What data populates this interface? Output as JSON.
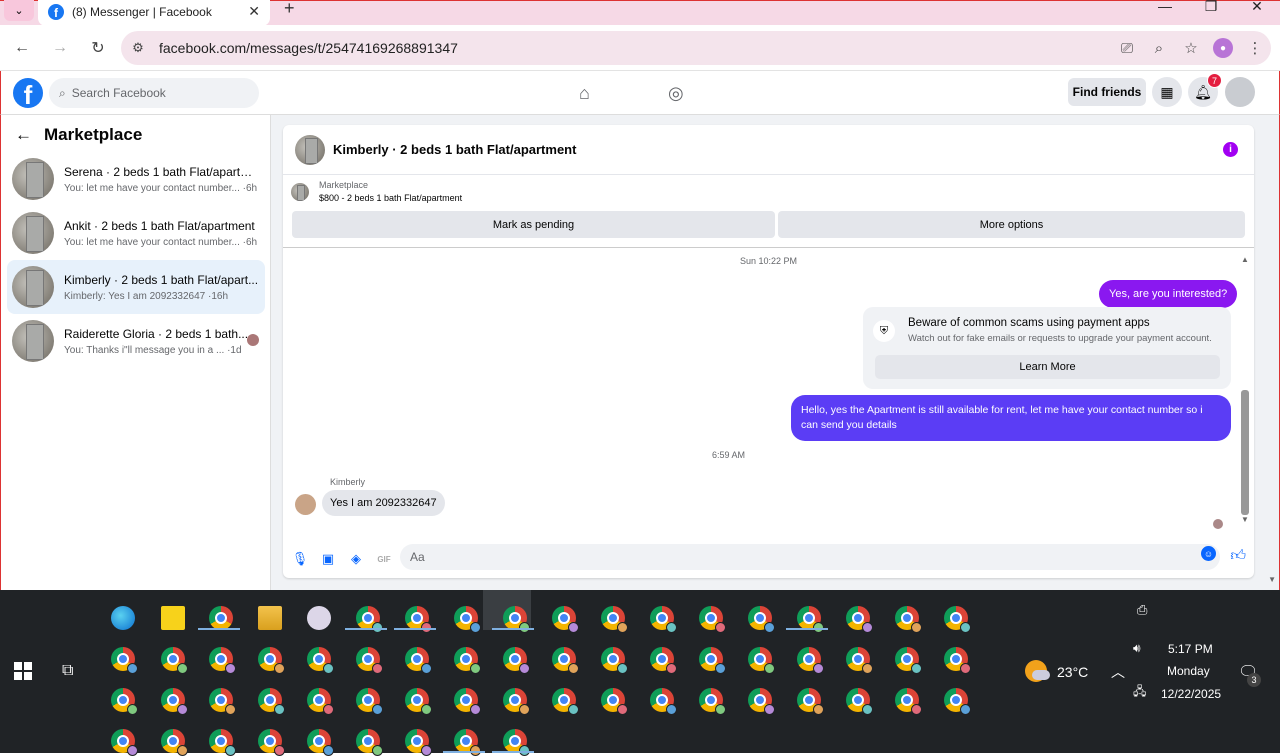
{
  "browser": {
    "tab_title": "(8) Messenger | Facebook",
    "url": "facebook.com/messages/t/25474169268891347"
  },
  "header": {
    "search_placeholder": "Search Facebook",
    "find_friends": "Find friends",
    "notification_count": "7"
  },
  "sidebar": {
    "title": "Marketplace",
    "conversations": [
      {
        "name": "Serena · 2 beds 1 bath Flat/apartm...",
        "snippet": "You: let me have your contact number... ·6h"
      },
      {
        "name": "Ankit · 2 beds 1 bath Flat/apartment",
        "snippet": "You: let me have your contact number... ·6h"
      },
      {
        "name": "Kimberly · 2 beds 1 bath Flat/apart...",
        "snippet": "Kimberly: Yes I am 2092332647 ·16h"
      },
      {
        "name": "Raiderette Gloria · 2 beds 1 bath...",
        "snippet": "You: Thanks i\"ll message you in a ... ·1d"
      }
    ]
  },
  "chat": {
    "title": "Kimberly · 2 beds 1 bath Flat/apartment",
    "listing_label": "Marketplace",
    "listing_desc": "$800 - 2 beds 1 bath Flat/apartment",
    "mark_pending": "Mark as pending",
    "more_options": "More options",
    "ts1": "Sun 10:22 PM",
    "msg_me1": "Yes, are you interested?",
    "scam_title": "Beware of common scams using payment apps",
    "scam_desc": "Watch out for fake emails or requests to upgrade your payment account.",
    "learn_more": "Learn More",
    "msg_me2": "Hello, yes the Apartment is still available for rent, let me have your contact number so i can send you details",
    "ts2": "6:59 AM",
    "sender": "Kimberly",
    "msg_them": "Yes I am 2092332647",
    "composer_placeholder": "Aa"
  },
  "taskbar": {
    "weather": "23°C",
    "time": "5:17 PM",
    "day": "Monday",
    "date": "12/22/2025",
    "notif_count": "3"
  }
}
